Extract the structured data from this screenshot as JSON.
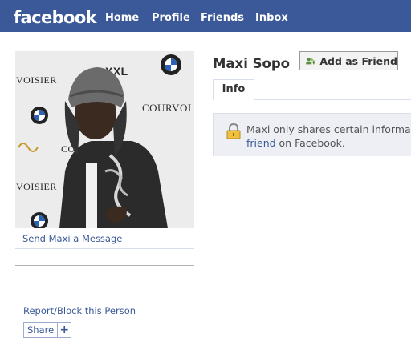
{
  "topbar": {
    "logo": "facebook",
    "nav": [
      "Home",
      "Profile",
      "Friends",
      "Inbox"
    ]
  },
  "profile": {
    "name": "Maxi Sopo",
    "add_friend_label": "Add as Friend",
    "send_message_link": "Send Maxi a Message",
    "report_link": "Report/Block this Person",
    "share_label": "Share",
    "share_plus": "+",
    "photo_backdrop_text": [
      "VOISIER",
      "COURVOI",
      "CO",
      "VOISIER",
      "XXL"
    ]
  },
  "tabs": {
    "info": "Info"
  },
  "notice": {
    "text_before": "Maxi only shares certain informa",
    "link_text": "friend",
    "text_after": " on Facebook."
  },
  "colors": {
    "brand_blue": "#3b5998",
    "notice_bg": "#edeff4",
    "border": "#d8dfea"
  },
  "icons": [
    "add-friend-icon",
    "lock-icon",
    "plus-icon"
  ]
}
